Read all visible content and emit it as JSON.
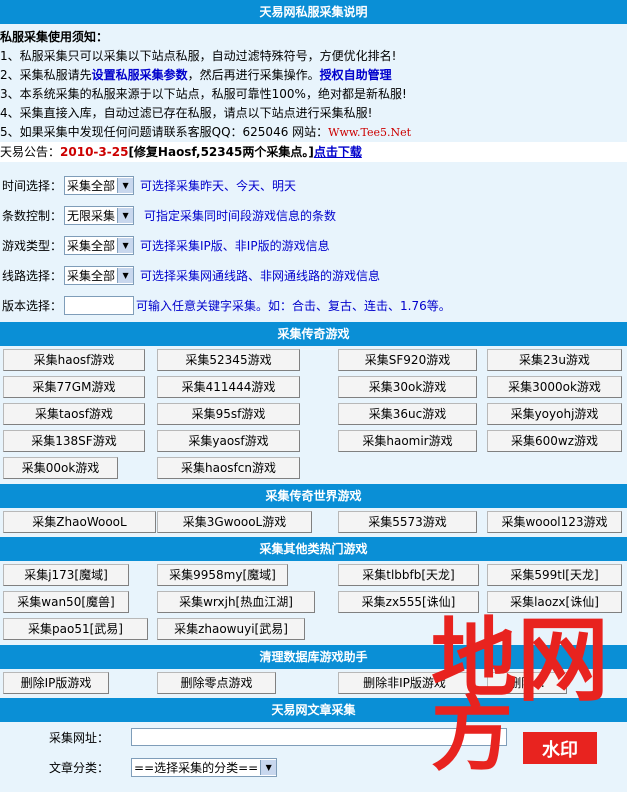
{
  "title_bar": "天易网私服采集说明",
  "notice": {
    "heading": "私服采集使用须知：",
    "line1": "1、私服采集只可以采集以下站点私服，自动过滤特殊符号，方便优化排名!",
    "line2_pre": "2、采集私服请先",
    "line2_link1": "设置私服采集参数",
    "line2_mid": "，然后再进行采集操作。",
    "line2_link2": "授权自助管理",
    "line3": "3、本系统采集的私服来源于以下站点，私服可靠性100%，绝对都是新私服!",
    "line4": "4、采集直接入库，自动过滤已存在私服，请点以下站点进行采集私服!",
    "line5_pre": "5、如果采集中发现任何问题请联系客服QQ：625046  网站：",
    "line5_site": "Www.Tee5.Net"
  },
  "announce": {
    "label": "天易公告：",
    "date": "2010-3-25",
    "text": "[修复Haosf,52345两个采集点。]",
    "link": "点击下载"
  },
  "form": {
    "time": {
      "label": "时间选择：",
      "value": "采集全部",
      "hint": "可选择采集昨天、今天、明天"
    },
    "count": {
      "label": "条数控制：",
      "value": "无限采集",
      "hint": "可指定采集同时间段游戏信息的条数"
    },
    "type": {
      "label": "游戏类型：",
      "value": "采集全部",
      "hint": "可选择采集IP版、非IP版的游戏信息"
    },
    "line": {
      "label": "线路选择：",
      "value": "采集全部",
      "hint": "可选择采集网通线路、非网通线路的游戏信息"
    },
    "version": {
      "label": "版本选择：",
      "hint": "可输入任意关键字采集。如：合击、复古、连击、1.76等。"
    }
  },
  "sections": {
    "legend": "采集传奇游戏",
    "world": "采集传奇世界游戏",
    "other": "采集其他类热门游戏",
    "clean": "清理数据库游戏助手",
    "article": "天易网文章采集"
  },
  "legend_buttons": [
    "采集haosf游戏",
    "采集52345游戏",
    "采集SF920游戏",
    "采集23u游戏",
    "采集77GM游戏",
    "采集411444游戏",
    "采集30ok游戏",
    "采集3000ok游戏",
    "采集taosf游戏",
    "采集95sf游戏",
    "采集36uc游戏",
    "采集yoyohj游戏",
    "采集138SF游戏",
    "采集yaosf游戏",
    "采集haomir游戏",
    "采集600wz游戏",
    "采集00ok游戏",
    "采集haosfcn游戏"
  ],
  "world_buttons": [
    "采集ZhaoWoooL",
    "采集3GwoooL游戏",
    "采集5573游戏",
    "采集woool123游戏"
  ],
  "other_buttons": [
    "采集j173[魔域]",
    "采集9958my[魔域]",
    "采集tlbbfb[天龙]",
    "采集599tl[天龙]",
    "采集wan50[魔兽]",
    "采集wrxjh[热血江湖]",
    "采集zx555[诛仙]",
    "采集laozx[诛仙]",
    "采集pao51[武易]",
    "采集zhaowuyi[武易]"
  ],
  "clean_buttons": [
    "删除IP版游戏",
    "删除零点游戏",
    "删除非IP版游戏",
    "删除..."
  ],
  "article": {
    "url_label": "采集网址：",
    "cat_label": "文章分类：",
    "cat_value": "==选择采集的分类=="
  },
  "watermark": {
    "big1": "地",
    "big2": "网",
    "big3": "方",
    "stamp": "水印",
    "color": "#e8231f"
  }
}
